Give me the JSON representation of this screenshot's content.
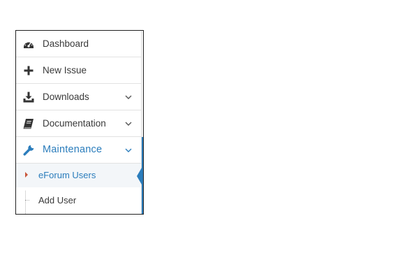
{
  "menu": {
    "items": [
      {
        "label": "Dashboard",
        "icon": "tachometer-icon",
        "has_submenu": false
      },
      {
        "label": "New Issue",
        "icon": "plus-icon",
        "has_submenu": false
      },
      {
        "label": "Downloads",
        "icon": "download-icon",
        "has_submenu": true
      },
      {
        "label": "Documentation",
        "icon": "book-icon",
        "has_submenu": true
      },
      {
        "label": "Maintenance",
        "icon": "wrench-icon",
        "has_submenu": true,
        "active": true
      }
    ],
    "submenu": {
      "items": [
        {
          "label": "eForum Users",
          "current": true
        },
        {
          "label": "Add User",
          "current": false
        }
      ]
    }
  },
  "colors": {
    "accent": "#2b7dbc",
    "text": "#393939",
    "icon": "#333333",
    "caret": "#c8563b",
    "divider": "#e2e2e2"
  }
}
